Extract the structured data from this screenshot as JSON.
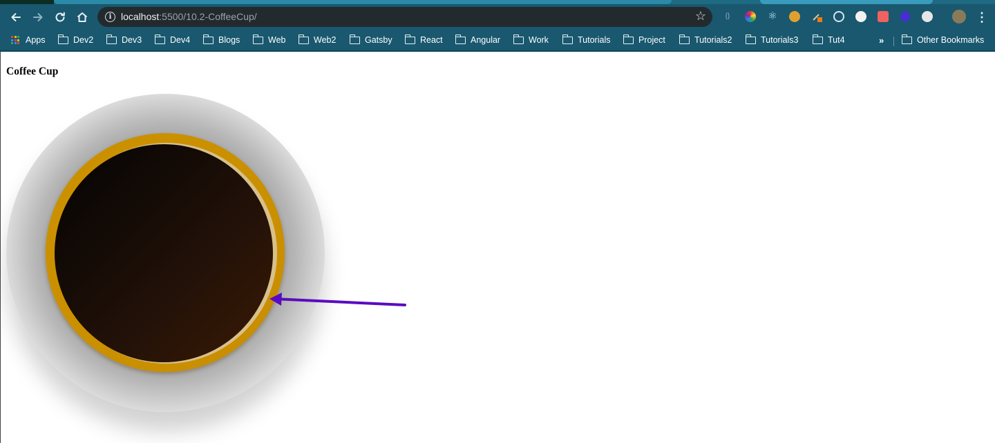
{
  "browser": {
    "url_host": "localhost",
    "url_rest": ":5500/10.2-CoffeeCup/",
    "bookmarks": [
      {
        "label": "Apps",
        "icon": "apps-grid-icon"
      },
      {
        "label": "Dev2",
        "icon": "folder-icon"
      },
      {
        "label": "Dev3",
        "icon": "folder-icon"
      },
      {
        "label": "Dev4",
        "icon": "folder-icon"
      },
      {
        "label": "Blogs",
        "icon": "folder-icon"
      },
      {
        "label": "Web",
        "icon": "folder-icon"
      },
      {
        "label": "Web2",
        "icon": "folder-icon"
      },
      {
        "label": "Gatsby",
        "icon": "folder-icon"
      },
      {
        "label": "React",
        "icon": "folder-icon"
      },
      {
        "label": "Angular",
        "icon": "folder-icon"
      },
      {
        "label": "Work",
        "icon": "folder-icon"
      },
      {
        "label": "Tutorials",
        "icon": "folder-icon"
      },
      {
        "label": "Project",
        "icon": "folder-icon"
      },
      {
        "label": "Tutorials2",
        "icon": "folder-icon"
      },
      {
        "label": "Tutorials3",
        "icon": "folder-icon"
      },
      {
        "label": "Tut4",
        "icon": "folder-icon"
      }
    ],
    "overflow_label": "»",
    "other_bookmarks": "Other Bookmarks",
    "colors": {
      "chrome": "#19586f",
      "omnibox": "#232a2e"
    }
  },
  "page": {
    "title": "Coffee Cup",
    "colors": {
      "rim": "#d79b00",
      "coffee": "#221108",
      "arrow": "#5a0bc0"
    }
  }
}
